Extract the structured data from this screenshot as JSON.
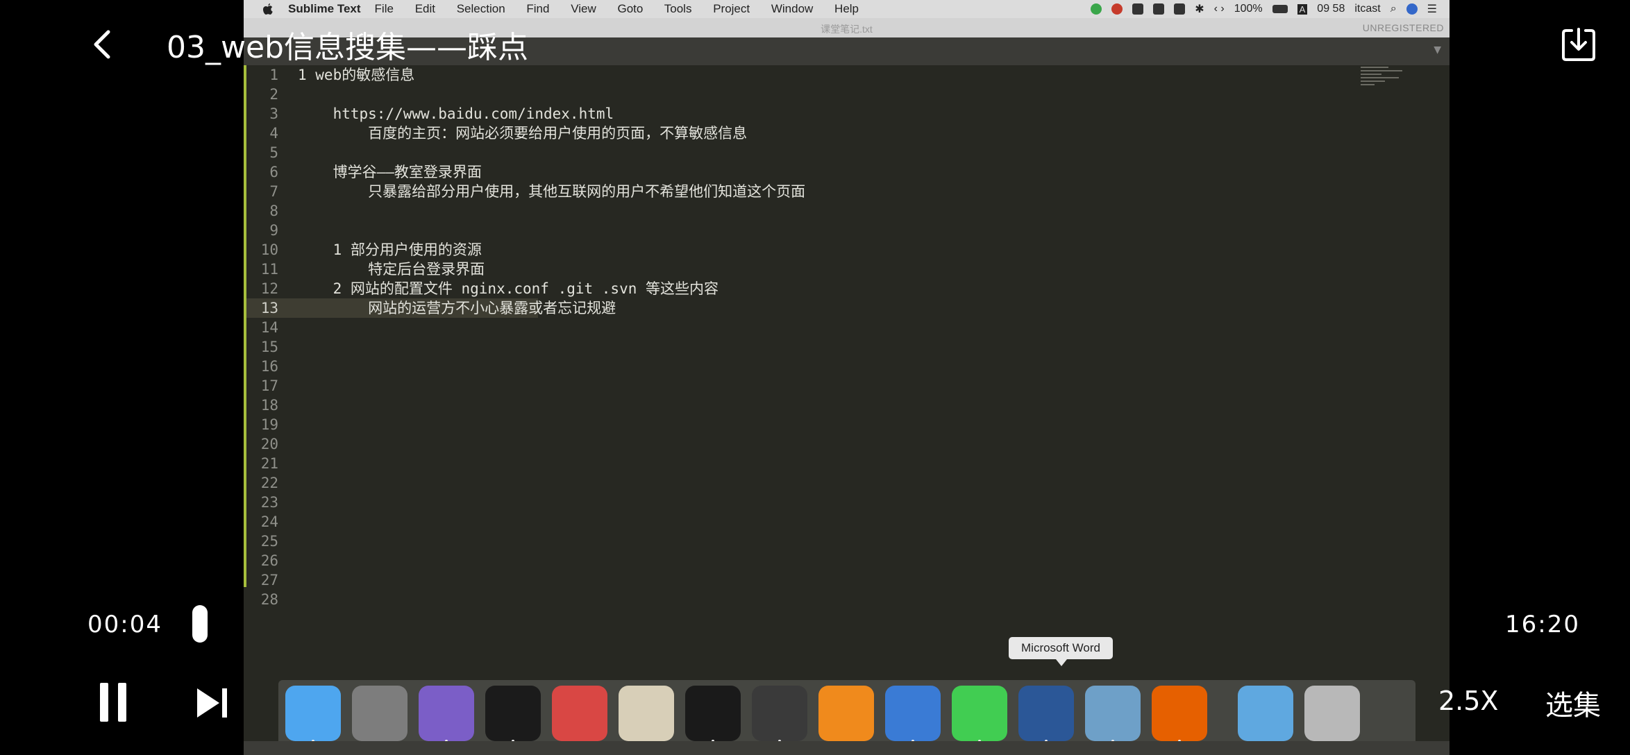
{
  "player": {
    "title": "03_web信息搜集——踩点",
    "current_time": "00:04",
    "total_time": "16:20",
    "speed": "2.5X",
    "episodes_label": "选集",
    "progress_fraction": 0.004
  },
  "menubar": {
    "apple": "",
    "app_name": "Sublime Text",
    "menus": [
      "File",
      "Edit",
      "Selection",
      "Find",
      "View",
      "Goto",
      "Tools",
      "Project",
      "Window",
      "Help"
    ],
    "battery": "100%",
    "input_source": "A",
    "clock": "09 58",
    "user": "itcast"
  },
  "window": {
    "document_title": "课堂笔记.txt",
    "unregistered": "UNREGISTERED"
  },
  "editor": {
    "current_line": 13,
    "lines": [
      "1 web的敏感信息",
      "",
      "    https://www.baidu.com/index.html",
      "        百度的主页：网站必须要给用户使用的页面，不算敏感信息",
      "",
      "    博学谷——教室登录界面",
      "        只暴露给部分用户使用，其他互联网的用户不希望他们知道这个页面",
      "",
      "",
      "    1 部分用户使用的资源",
      "        特定后台登录界面",
      "    2 网站的配置文件 nginx.conf .git .svn 等这些内容",
      "        网站的运营方不小心暴露或者忘记规避",
      "",
      "",
      "",
      "",
      "",
      "",
      "",
      "",
      "",
      "",
      "",
      "",
      "",
      "",
      ""
    ]
  },
  "dock": {
    "tooltip": "Microsoft Word",
    "apps": [
      {
        "name": "finder",
        "color": "#4ea6ef"
      },
      {
        "name": "launchpad",
        "color": "#7d7d7d"
      },
      {
        "name": "emacs",
        "color": "#7b5ec7"
      },
      {
        "name": "terminal",
        "color": "#1b1b1b"
      },
      {
        "name": "pdf-expert",
        "color": "#d94744"
      },
      {
        "name": "textedit",
        "color": "#d8cfb8"
      },
      {
        "name": "obs",
        "color": "#1a1a1a"
      },
      {
        "name": "sublime-text",
        "color": "#3a3a3a"
      },
      {
        "name": "vlc",
        "color": "#f08a1c"
      },
      {
        "name": "vmware",
        "color": "#3a7bd5"
      },
      {
        "name": "qt-creator",
        "color": "#41cd52"
      },
      {
        "name": "microsoft-word",
        "color": "#2b5797"
      },
      {
        "name": "preview",
        "color": "#6ea0c8"
      },
      {
        "name": "firefox",
        "color": "#e66000"
      },
      {
        "name": "downloads-folder",
        "color": "#5fa8e0"
      },
      {
        "name": "trash",
        "color": "#b8b8b8"
      }
    ]
  }
}
